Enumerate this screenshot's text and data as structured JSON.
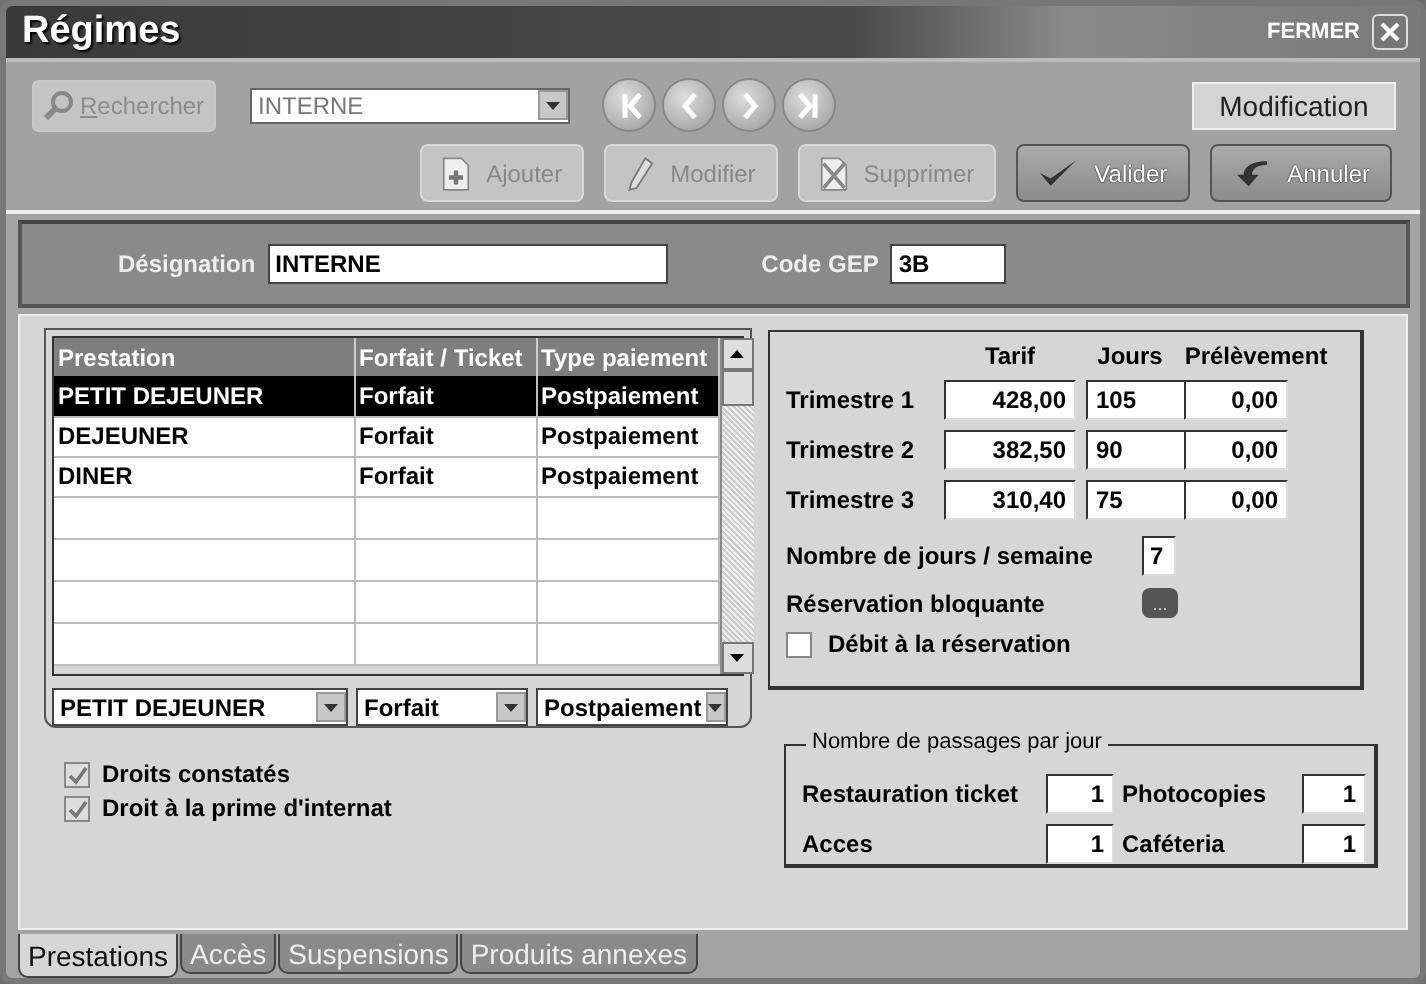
{
  "window": {
    "title": "Régimes",
    "close_label": "FERMER"
  },
  "toolbar": {
    "search_button": {
      "label": "Rechercher",
      "disabled": true
    },
    "record_combo": {
      "value": "INTERNE"
    },
    "mode": "Modification",
    "buttons": [
      {
        "kind": "add",
        "label": "Ajouter",
        "disabled": true
      },
      {
        "kind": "edit",
        "label": "Modifier",
        "disabled": true
      },
      {
        "kind": "delete",
        "label": "Supprimer",
        "disabled": true
      },
      {
        "kind": "validate",
        "label": "Valider",
        "disabled": false
      },
      {
        "kind": "cancel",
        "label": "Annuler",
        "disabled": false
      }
    ]
  },
  "header": {
    "designation_label": "Désignation",
    "designation": "INTERNE",
    "code_label": "Code GEP",
    "code": "3B"
  },
  "table": {
    "columns": [
      "Prestation",
      "Forfait / Ticket",
      "Type paiement"
    ],
    "rows": [
      {
        "cells": [
          "PETIT DEJEUNER",
          "Forfait",
          "Postpaiement"
        ],
        "selected": true
      },
      {
        "cells": [
          "DEJEUNER",
          "Forfait",
          "Postpaiement"
        ],
        "selected": false
      },
      {
        "cells": [
          "DINER",
          "Forfait",
          "Postpaiement"
        ],
        "selected": false
      }
    ],
    "editors": [
      "PETIT DEJEUNER",
      "Forfait",
      "Postpaiement"
    ]
  },
  "tarifs": {
    "columns": [
      "Tarif",
      "Jours",
      "Prélèvement"
    ],
    "rows": [
      {
        "label": "Trimestre 1",
        "tarif": "428,00",
        "jours": "105",
        "prelevement": "0,00"
      },
      {
        "label": "Trimestre 2",
        "tarif": "382,50",
        "jours": "90",
        "prelevement": "0,00"
      },
      {
        "label": "Trimestre 3",
        "tarif": "310,40",
        "jours": "75",
        "prelevement": "0,00"
      }
    ],
    "days_label": "Nombre de jours / semaine",
    "days": "7",
    "blocking_label": "Réservation bloquante",
    "blocking_button": "...",
    "debit": {
      "label": "Débit à la réservation",
      "checked": false
    }
  },
  "rights": [
    {
      "label": "Droits constatés",
      "checked": true
    },
    {
      "label": "Droit à la prime d'internat",
      "checked": true
    }
  ],
  "passages": {
    "title": "Nombre de passages par jour",
    "items": [
      {
        "label": "Restauration ticket",
        "value": "1"
      },
      {
        "label": "Photocopies",
        "value": "1"
      },
      {
        "label": "Acces",
        "value": "1"
      },
      {
        "label": "Caféteria",
        "value": "1"
      }
    ]
  },
  "tabs": [
    {
      "label": "Prestations",
      "selected": true
    },
    {
      "label": "Accès",
      "selected": false
    },
    {
      "label": "Suspensions",
      "selected": false
    },
    {
      "label": "Produits annexes",
      "selected": false
    }
  ]
}
